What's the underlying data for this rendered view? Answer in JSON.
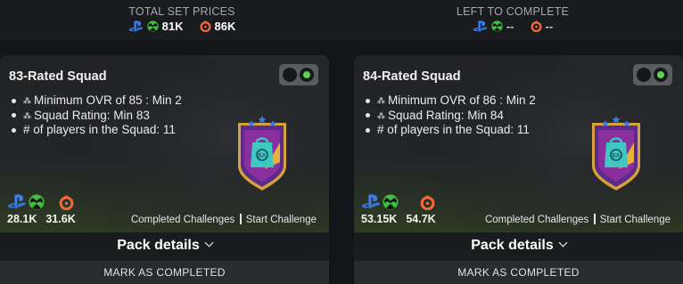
{
  "summary": {
    "total_title": "TOTAL SET PRICES",
    "total_console": "81K",
    "total_pc": "86K",
    "left_title": "LEFT TO COMPLETE",
    "left_console": "--",
    "left_pc": "--"
  },
  "cards": [
    {
      "title": "83-Rated Squad",
      "requirements": [
        "Minimum OVR of 85 : Min 2",
        "Squad Rating: Min 83",
        "# of players in the Squad: 11"
      ],
      "price_console": "28.1K",
      "price_pc": "31.6K",
      "completed_label": "Completed Challenges",
      "start_label": "Start Challenge",
      "pack_label": "Pack details",
      "mark_label": "MARK AS COMPLETED"
    },
    {
      "title": "84-Rated Squad",
      "requirements": [
        "Minimum OVR of 86 : Min 2",
        "Squad Rating: Min 84",
        "# of players in the Squad: 11"
      ],
      "price_console": "53.15K",
      "price_pc": "54.7K",
      "completed_label": "Completed Challenges",
      "start_label": "Start Challenge",
      "pack_label": "Pack details",
      "mark_label": "MARK AS COMPLETED"
    }
  ],
  "icons": {
    "playstation": "playstation-icon",
    "xbox": "xbox-icon",
    "origin": "origin-icon",
    "badge": "ea-pack-badge-icon"
  },
  "colors": {
    "playstation": "#3b7be8",
    "xbox": "#3fbf3f",
    "origin": "#f2673a",
    "toggle_on": "#5bd24a"
  }
}
